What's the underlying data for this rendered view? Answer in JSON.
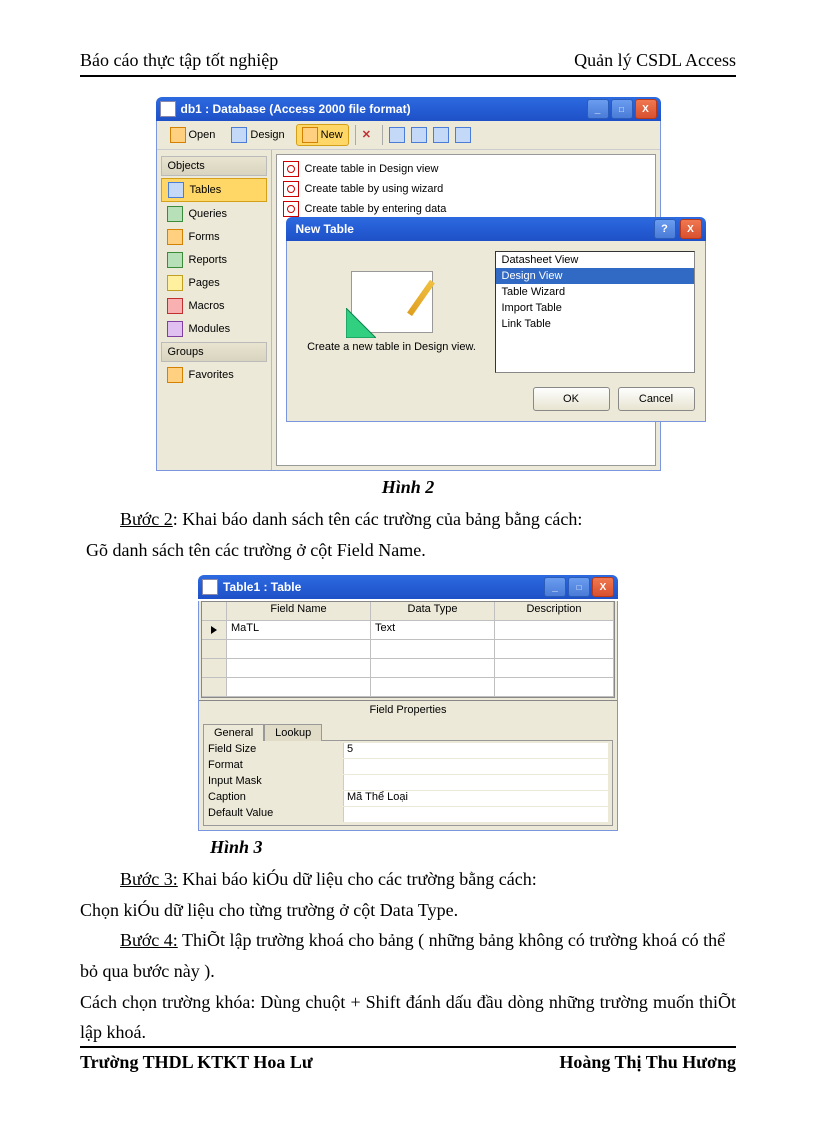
{
  "header": {
    "left": "Báo cáo thực tập tốt nghiệp",
    "right": "Quản lý CSDL Access"
  },
  "footer": {
    "left": "Trường THDL KTKT Hoa Lư",
    "right": "Hoàng Thị Thu Hương"
  },
  "fig2": {
    "title": "db1 : Database (Access 2000 file format)",
    "toolbar": {
      "open": "Open",
      "design": "Design",
      "new": "New"
    },
    "sidebar": {
      "objects": "Objects",
      "tables": "Tables",
      "queries": "Queries",
      "forms": "Forms",
      "reports": "Reports",
      "pages": "Pages",
      "macros": "Macros",
      "modules": "Modules",
      "groups": "Groups",
      "favorites": "Favorites"
    },
    "list": {
      "opt1": "Create table in Design view",
      "opt2": "Create table by using wizard",
      "opt3": "Create table by entering data"
    },
    "dialog": {
      "title": "New Table",
      "desc": "Create a new table in Design view.",
      "options": {
        "o1": "Datasheet View",
        "o2": "Design View",
        "o3": "Table Wizard",
        "o4": "Import Table",
        "o5": "Link Table"
      },
      "ok": "OK",
      "cancel": "Cancel"
    }
  },
  "caption2": "Hình 2",
  "step2": {
    "label": "Bước 2",
    "text": ": Khai báo danh sách tên các trường của bảng bằng cách:",
    "sub": "Gõ danh sách tên các trường ở cột Field Name."
  },
  "fig3": {
    "title": "Table1 : Table",
    "cols": {
      "fn": "Field Name",
      "dt": "Data Type",
      "de": "Description"
    },
    "row1": {
      "fn": "MaTL",
      "dt": "Text"
    },
    "fprops": "Field Properties",
    "tabs": {
      "general": "General",
      "lookup": "Lookup"
    },
    "props": {
      "fieldsize_l": "Field Size",
      "fieldsize_v": "5",
      "format_l": "Format",
      "format_v": "",
      "inputmask_l": "Input Mask",
      "inputmask_v": "",
      "caption_l": "Caption",
      "caption_v": "Mã Thể Loại",
      "default_l": "Default Value",
      "default_v": ""
    }
  },
  "caption3": "Hình 3",
  "step3": {
    "label": "Bước 3:",
    "text": " Khai báo kiÓu dữ liệu cho các trường bằng cách:",
    "sub": "Chọn kiÓu dữ liệu cho từng trường ở cột Data Type."
  },
  "step4": {
    "label": "Bước 4:",
    "text": " ThiÕt lập trường khoá cho bảng ( những bảng không có trường khoá có thể bỏ qua bước này ).",
    "sub": "Cách chọn trường khóa: Dùng chuột + Shift đánh dấu đầu dòng những trường muốn thiÕt lập khoá."
  }
}
